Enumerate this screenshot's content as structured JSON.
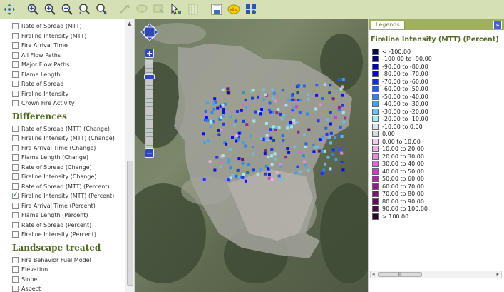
{
  "toolbar": {
    "buttons": [
      "pan-tool",
      "zoom-extent",
      "zoom-in",
      "zoom-out",
      "zoom-previous",
      "zoom-next",
      "measure-disabled",
      "identify-disabled",
      "select-disabled",
      "info-disabled",
      "clear-disabled",
      "export-map",
      "spell-check",
      "settings"
    ]
  },
  "layers": {
    "top_items": [
      {
        "label": "Rate of Spread (MTT)",
        "checked": false
      },
      {
        "label": "Fireline Intensity (MTT)",
        "checked": false
      },
      {
        "label": "Fire Arrival Time",
        "checked": false
      },
      {
        "label": "All Flow Paths",
        "checked": false
      },
      {
        "label": "Major Flow Paths",
        "checked": false
      },
      {
        "label": "Flame Length",
        "checked": false
      },
      {
        "label": "Rate of Spread",
        "checked": false
      },
      {
        "label": "Fireline Intensity",
        "checked": false
      },
      {
        "label": "Crown Fire Activity",
        "checked": false
      }
    ],
    "differences_heading": "Differences",
    "difference_items": [
      {
        "label": "Rate of Spread (MTT) (Change)",
        "checked": false
      },
      {
        "label": "Fireline Intensity (MTT) (Change)",
        "checked": false
      },
      {
        "label": "Fire Arrival Time (Change)",
        "checked": false
      },
      {
        "label": "Flame Length (Change)",
        "checked": false
      },
      {
        "label": "Rate of Spread (Change)",
        "checked": false
      },
      {
        "label": "Fireline Intensity (Change)",
        "checked": false
      },
      {
        "label": "Rate of Spread (MTT) (Percent)",
        "checked": false
      },
      {
        "label": "Fireline Intensity (MTT) (Percent)",
        "checked": true
      },
      {
        "label": "Fire Arrival Time (Percent)",
        "checked": false
      },
      {
        "label": "Flame Length (Percent)",
        "checked": false
      },
      {
        "label": "Rate of Spread (Percent)",
        "checked": false
      },
      {
        "label": "Fireline Intensity (Percent)",
        "checked": false
      }
    ],
    "landscape_heading": "Landscape treated",
    "landscape_items": [
      {
        "label": "Fire Behavior Fuel Model",
        "checked": false
      },
      {
        "label": "Elevation",
        "checked": false
      },
      {
        "label": "Slope",
        "checked": false
      },
      {
        "label": "Aspect",
        "checked": false
      }
    ]
  },
  "map": {
    "zoom_in_label": "+",
    "zoom_out_label": "−"
  },
  "legend": {
    "tab_label": "Legends",
    "collapse_label": "»",
    "title": "Fireline Intensity (MTT) (Percent)",
    "scroll_thumb": "III",
    "entries": [
      {
        "label": "< -100.00",
        "color": "#0a0a40"
      },
      {
        "label": "-100.00 to -90.00",
        "color": "#00007a"
      },
      {
        "label": "-90.00 to -80.00",
        "color": "#0000b0"
      },
      {
        "label": "-80.00 to -70.00",
        "color": "#0000e0"
      },
      {
        "label": "-70.00 to -60.00",
        "color": "#1030f0"
      },
      {
        "label": "-60.00 to -50.00",
        "color": "#1d60ec"
      },
      {
        "label": "-50.00 to -40.00",
        "color": "#2f86e8"
      },
      {
        "label": "-40.00 to -30.00",
        "color": "#43a2e8"
      },
      {
        "label": "-30.00 to -20.00",
        "color": "#6cc0ea"
      },
      {
        "label": "-20.00 to -10.00",
        "color": "#a5ecf4"
      },
      {
        "label": "-10.00 to 0.00",
        "color": "#d7e5ea"
      },
      {
        "label": "0.00",
        "color": "#d8d8d8"
      },
      {
        "label": "0.00 to 10.00",
        "color": "#f2c8ef"
      },
      {
        "label": "10.00 to 20.00",
        "color": "#ecaee8"
      },
      {
        "label": "20.00 to 30.00",
        "color": "#e48ee0"
      },
      {
        "label": "30.00 to 40.00",
        "color": "#d968d6"
      },
      {
        "label": "40.00 to 50.00",
        "color": "#c840c4"
      },
      {
        "label": "50.00 to 60.00",
        "color": "#aa27a6"
      },
      {
        "label": "60.00 to 70.00",
        "color": "#8f1c8b"
      },
      {
        "label": "70.00 to 80.00",
        "color": "#7a1676"
      },
      {
        "label": "80.00 to 90.00",
        "color": "#5e0f5a"
      },
      {
        "label": "90.00 to 100.00",
        "color": "#4a0b46"
      },
      {
        "label": "> 100.00",
        "color": "#2a052a"
      }
    ]
  }
}
